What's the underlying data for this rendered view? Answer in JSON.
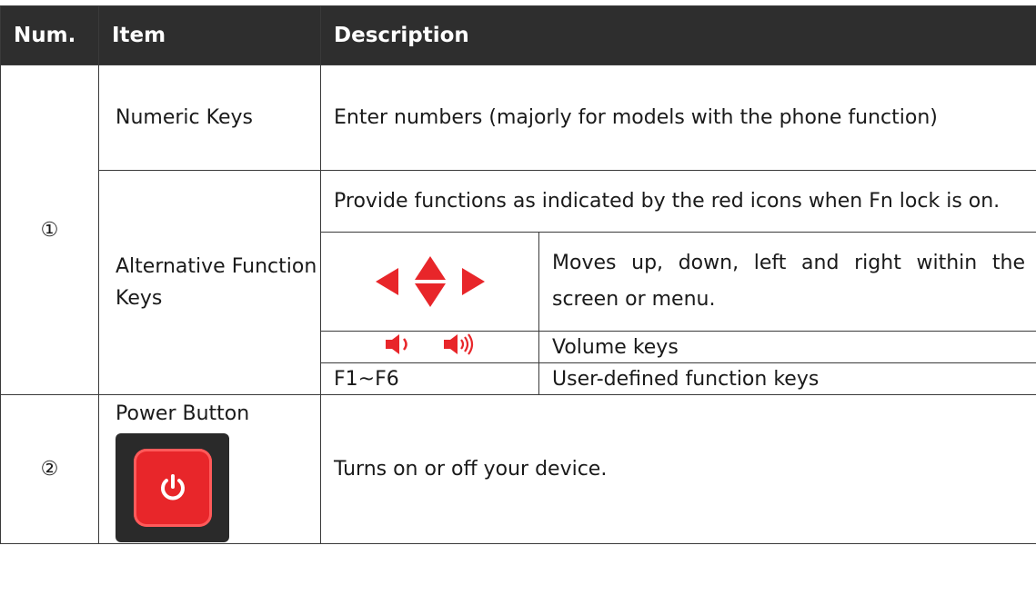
{
  "table": {
    "headers": {
      "num": "Num.",
      "item": "Item",
      "description": "Description"
    },
    "rows": {
      "numeric": {
        "num": "①",
        "item": "Numeric Keys",
        "description": "Enter numbers (majorly for models with the phone function)"
      },
      "alternative": {
        "item": "Alternative Function Keys",
        "description": "Provide functions as indicated by the red icons when Fn lock is on.",
        "subrows": {
          "arrows": {
            "icon": "arrow-keys-icon",
            "description": "Moves up, down, left and right within the screen or menu."
          },
          "volume": {
            "icon": "volume-keys-icon",
            "description": "Volume keys"
          },
          "fkeys": {
            "key": "F1~F6",
            "description": "User-defined function keys"
          }
        }
      },
      "power": {
        "num": "②",
        "item": "Power Button",
        "description": "Turns on or off your device."
      }
    }
  },
  "colors": {
    "header_bg": "#2e2e2e",
    "icon_red": "#e8262a"
  }
}
